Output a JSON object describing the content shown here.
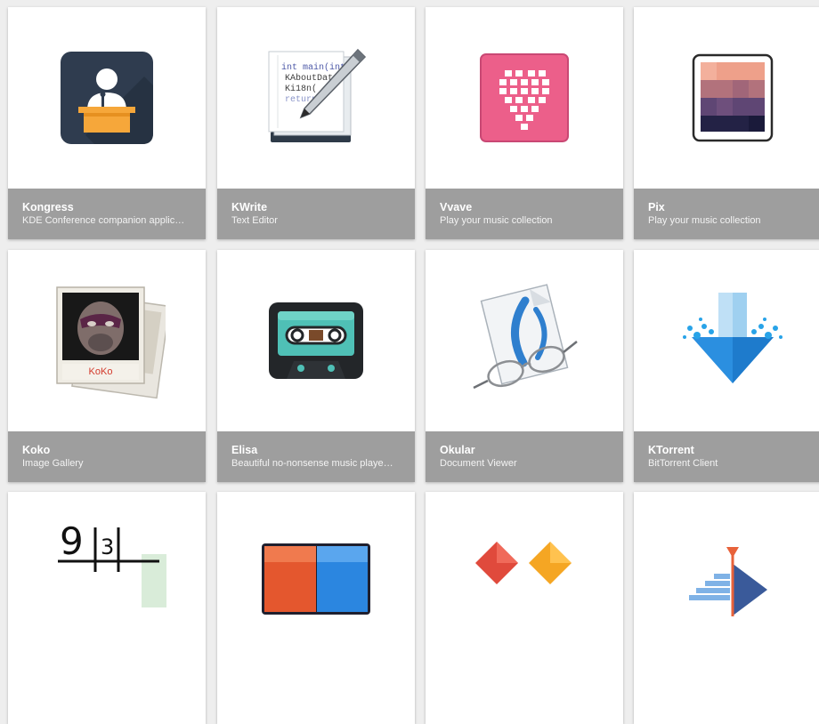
{
  "apps": [
    {
      "name": "Kongress",
      "description": "KDE Conference companion applic…",
      "icon": "presenter-podium-icon"
    },
    {
      "name": "KWrite",
      "description": "Text Editor",
      "icon": "text-editor-pen-icon"
    },
    {
      "name": "Vvave",
      "description": "Play your music collection",
      "icon": "pink-heart-grid-icon"
    },
    {
      "name": "Pix",
      "description": "Play your music collection",
      "icon": "gradient-picture-frame-icon"
    },
    {
      "name": "Koko",
      "description": "Image Gallery",
      "icon": "gorilla-photo-icon"
    },
    {
      "name": "Elisa",
      "description": "Beautiful no-nonsense music playe…",
      "icon": "cassette-tape-icon"
    },
    {
      "name": "Okular",
      "description": "Document Viewer",
      "icon": "document-glasses-icon"
    },
    {
      "name": "KTorrent",
      "description": "BitTorrent Client",
      "icon": "download-arrow-splash-icon"
    },
    {
      "name": "",
      "description": "",
      "icon": "sudoku-numbers-icon"
    },
    {
      "name": "",
      "description": "",
      "icon": "red-blue-panels-icon"
    },
    {
      "name": "",
      "description": "",
      "icon": "red-orange-diamonds-icon"
    },
    {
      "name": "",
      "description": "",
      "icon": "stairs-triangle-icon"
    }
  ],
  "kwrite_code": [
    "int main(int",
    "KAboutDat",
    "Ki18n(",
    "return"
  ],
  "koko_label": "KoKo",
  "sudoku_digits": [
    "9",
    "3"
  ]
}
